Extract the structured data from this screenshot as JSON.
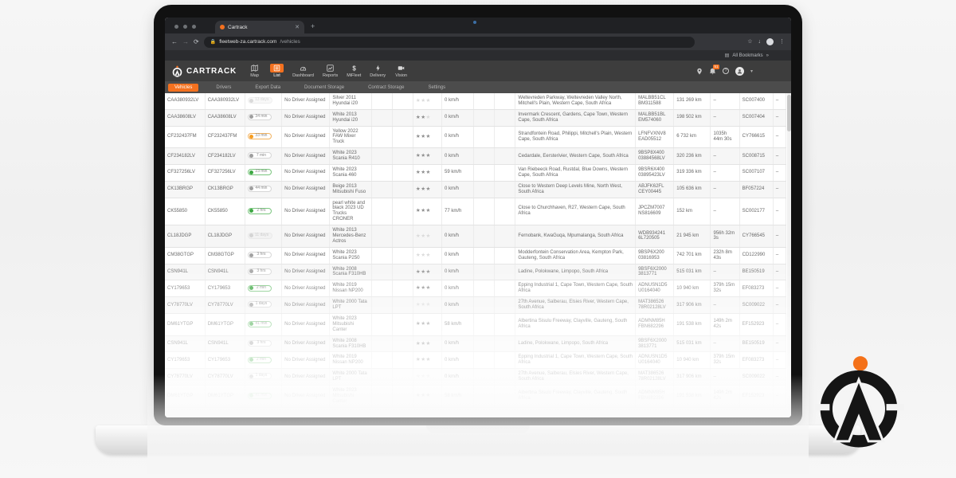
{
  "browser": {
    "tab_title": "Cartrack",
    "url_host": "fleetweb-za.cartrack.com",
    "url_path": "/vehicles",
    "bookmarks_label": "All Bookmarks"
  },
  "header": {
    "brand": "CARTRACK",
    "notification_count": "51",
    "nav": [
      {
        "label": "Map",
        "icon": "map",
        "active": false
      },
      {
        "label": "List",
        "icon": "list",
        "active": true
      },
      {
        "label": "Dashboard",
        "icon": "dashboard",
        "active": false
      },
      {
        "label": "Reports",
        "icon": "reports",
        "active": false
      },
      {
        "label": "MiFleet",
        "icon": "mifleet",
        "active": false
      },
      {
        "label": "Delivery",
        "icon": "delivery",
        "active": false
      },
      {
        "label": "Vision",
        "icon": "vision",
        "active": false
      }
    ]
  },
  "subnav": {
    "items": [
      {
        "label": "Vehicles",
        "active": true
      },
      {
        "label": "Drivers",
        "active": false
      },
      {
        "label": "Export Data",
        "active": false
      },
      {
        "label": "Document Storage",
        "active": false
      },
      {
        "label": "Contract Storage",
        "active": false
      },
      {
        "label": "Settings",
        "active": false
      }
    ]
  },
  "colors": {
    "accent_orange": "#f4711f",
    "status_green": "#3da843",
    "status_amber": "#f59c1f",
    "status_grey": "#9e9e9e"
  },
  "table": {
    "rows": [
      {
        "reg": "CAA380932LV",
        "status": {
          "text": "13 days",
          "level": "stale"
        },
        "driver": "No Driver Assigned",
        "vehicle": "Silver 2011 Hyundai i20",
        "rating": 0,
        "speed": "0 km/h",
        "location": "Weltevreden Parkway, Weltevreden Valley North, Mitchell's Plain, Western Cape, South Africa",
        "vin": "MALBB51CL BM311588",
        "odometer": "131 269 km",
        "hours": "–",
        "serial": "SC007400",
        "extra": "–"
      },
      {
        "reg": "CAA38608LV",
        "status": {
          "text": "34 min",
          "level": "grey"
        },
        "driver": "No Driver Assigned",
        "vehicle": "White 2013 Hyundai i20",
        "rating": 2,
        "speed": "0 km/h",
        "location": "Invermark Crescent, Gardens, Cape Town, Western Cape, South Africa",
        "vin": "MALBB51BL EM574060",
        "odometer": "198 502 km",
        "hours": "–",
        "serial": "SC007404",
        "extra": "–"
      },
      {
        "reg": "CF232437FM",
        "status": {
          "text": "33 min",
          "level": "orange"
        },
        "driver": "No Driver Assigned",
        "vehicle": "Yellow 2022 FAW Mixer Truck",
        "rating": 3,
        "speed": "0 km/h",
        "location": "Strandfontein Road, Philippi, Mitchell's Plain, Western Cape, South Africa",
        "vin": "LFNFVXNV8 EAD05512",
        "odometer": "6 732 km",
        "hours": "1035h 44m 30s",
        "serial": "CY766615",
        "extra": "–"
      },
      {
        "reg": "CF234182LV",
        "status": {
          "text": "7 min",
          "level": "grey"
        },
        "driver": "No Driver Assigned",
        "vehicle": "White 2023 Scania R410",
        "rating": 3,
        "speed": "0 km/h",
        "location": "Cedardale, Eersterivier, Western Cape, South Africa",
        "vin": "9BSP8X400 03884568LV",
        "odometer": "320 236 km",
        "hours": "–",
        "serial": "SC008715",
        "extra": "–"
      },
      {
        "reg": "CF327256LV",
        "status": {
          "text": "23 min",
          "level": "green"
        },
        "driver": "No Driver Assigned",
        "vehicle": "White 2023 Scania 460",
        "rating": 3,
        "speed": "59 km/h",
        "location": "Van Riebeeck Road, Rustdal, Blue Downs, Western Cape, South Africa",
        "vin": "9BSR6X400 03895423LV",
        "odometer": "319 336 km",
        "hours": "–",
        "serial": "SC007107",
        "extra": "–"
      },
      {
        "reg": "CK13BRGP",
        "status": {
          "text": "44 min",
          "level": "grey"
        },
        "driver": "No Driver Assigned",
        "vehicle": "Beige 2013 Mitsubishi Fuso",
        "rating": 3,
        "speed": "0 km/h",
        "location": "Close to Western Deep Levels Mine, North West, South Africa",
        "vin": "ABJFK62FL CEY00445",
        "odometer": "105 636 km",
        "hours": "–",
        "serial": "BF057224",
        "extra": "–"
      },
      {
        "reg": "CK55850",
        "status": {
          "text": "2 hrs",
          "level": "green"
        },
        "driver": "No Driver Assigned",
        "vehicle": "pearl white and black 2023 UD Trucks CRONER",
        "rating": 3,
        "speed": "77 km/h",
        "location": "Close to Churchhaven, R27, Western Cape, South Africa",
        "vin": "JPCZM7007 NS816609",
        "odometer": "152 km",
        "hours": "–",
        "serial": "SC002177",
        "extra": "–"
      },
      {
        "reg": "CL18JDGP",
        "status": {
          "text": "11 days",
          "level": "stale"
        },
        "driver": "No Driver Assigned",
        "vehicle": "White 2013 Mercedes-Benz Actros",
        "rating": 0,
        "speed": "0 km/h",
        "location": "Fernobank, KwaGuqa, Mpumalanga, South Africa",
        "vin": "WDB934241 6L720505",
        "odometer": "21 945 km",
        "hours": "956h 32m 3s",
        "serial": "CY766545",
        "extra": "–"
      },
      {
        "reg": "CM38GTGP",
        "status": {
          "text": "3 hrs",
          "level": "grey"
        },
        "driver": "No Driver Assigned",
        "vehicle": "White 2023 Scania P250",
        "rating": 0,
        "speed": "0 km/h",
        "location": "Modderfontein Conservation Area, Kempton Park, Gauteng, South Africa",
        "vin": "9BSP6X200 03816953",
        "odometer": "742 701 km",
        "hours": "232h 8m 43s",
        "serial": "CD122990",
        "extra": "–"
      },
      {
        "reg": "CSN941L",
        "status": {
          "text": "3 hrs",
          "level": "grey"
        },
        "driver": "No Driver Assigned",
        "vehicle": "White 2008 Scania F310HB",
        "rating": 3,
        "speed": "0 km/h",
        "location": "Ladine, Polokwane, Limpopo, South Africa",
        "vin": "9BSF6X2000 3813771",
        "odometer": "515 031 km",
        "hours": "–",
        "serial": "BE150519",
        "extra": "–"
      },
      {
        "reg": "CY179653",
        "status": {
          "text": "2 min",
          "level": "green"
        },
        "driver": "No Driver Assigned",
        "vehicle": "White 2019 Nissan NP200",
        "rating": 3,
        "speed": "0 km/h",
        "location": "Epping Industrial 1, Cape Town, Western Cape, South Africa",
        "vin": "ADNUSN1D5 U0164040",
        "odometer": "10 940 km",
        "hours": "379h 15m 32s",
        "serial": "EF083273",
        "extra": "–"
      },
      {
        "reg": "CY78770LV",
        "status": {
          "text": "1 days",
          "level": "grey"
        },
        "driver": "No Driver Assigned",
        "vehicle": "White 2000 Tata LPT",
        "rating": 0,
        "speed": "0 km/h",
        "location": "27th Avenue, Salberau, Elsies River, Western Cape, South Africa",
        "vin": "MAT386526 78R02128LV",
        "odometer": "317 906 km",
        "hours": "–",
        "serial": "SC009022",
        "extra": "–"
      },
      {
        "reg": "DM61YTGP",
        "status": {
          "text": "41 min",
          "level": "green"
        },
        "driver": "No Driver Assigned",
        "vehicle": "White 2023 Mitsubishi Canter",
        "rating": 3,
        "speed": "58 km/h",
        "location": "Albertina Sisulu Freeway, Clayville, Gauteng, South Africa",
        "vin": "ADMNM85H FBN682296",
        "odometer": "191 538 km",
        "hours": "149h 2m 42s",
        "serial": "EF152923",
        "extra": "–"
      },
      {
        "reg": "CSN941L",
        "status": {
          "text": "3 hrs",
          "level": "grey"
        },
        "driver": "No Driver Assigned",
        "vehicle": "White 2008 Scania F310HB",
        "rating": 3,
        "speed": "0 km/h",
        "location": "Ladine, Polokwane, Limpopo, South Africa",
        "vin": "9BSF6X2000 3813771",
        "odometer": "515 031 km",
        "hours": "–",
        "serial": "BE150519",
        "extra": "–"
      },
      {
        "reg": "CY179653",
        "status": {
          "text": "2 min",
          "level": "green"
        },
        "driver": "No Driver Assigned",
        "vehicle": "White 2019 Nissan NP200",
        "rating": 3,
        "speed": "0 km/h",
        "location": "Epping Industrial 1, Cape Town, Western Cape, South Africa",
        "vin": "ADNUSN1D5 U0164040",
        "odometer": "10 940 km",
        "hours": "379h 15m 32s",
        "serial": "EF083273",
        "extra": "–"
      },
      {
        "reg": "CY78770LV",
        "status": {
          "text": "1 days",
          "level": "grey"
        },
        "driver": "No Driver Assigned",
        "vehicle": "White 2000 Tata LPT",
        "rating": 0,
        "speed": "0 km/h",
        "location": "27th Avenue, Salberau, Elsies River, Western Cape, South Africa",
        "vin": "MAT386526 78R02128LV",
        "odometer": "317 906 km",
        "hours": "–",
        "serial": "SC009022",
        "extra": "–"
      },
      {
        "reg": "DM61YTGP",
        "status": {
          "text": "41 min",
          "level": "green"
        },
        "driver": "No Driver Assigned",
        "vehicle": "White 2023 Mitsubishi Canter",
        "rating": 3,
        "speed": "58 km/h",
        "location": "Albertina Sisulu Freeway, Clayville, Gauteng, South Africa",
        "vin": "ADMNM85H FBN682296",
        "odometer": "191 538 km",
        "hours": "149h 2m 42s",
        "serial": "EF152923",
        "extra": "–"
      }
    ]
  }
}
